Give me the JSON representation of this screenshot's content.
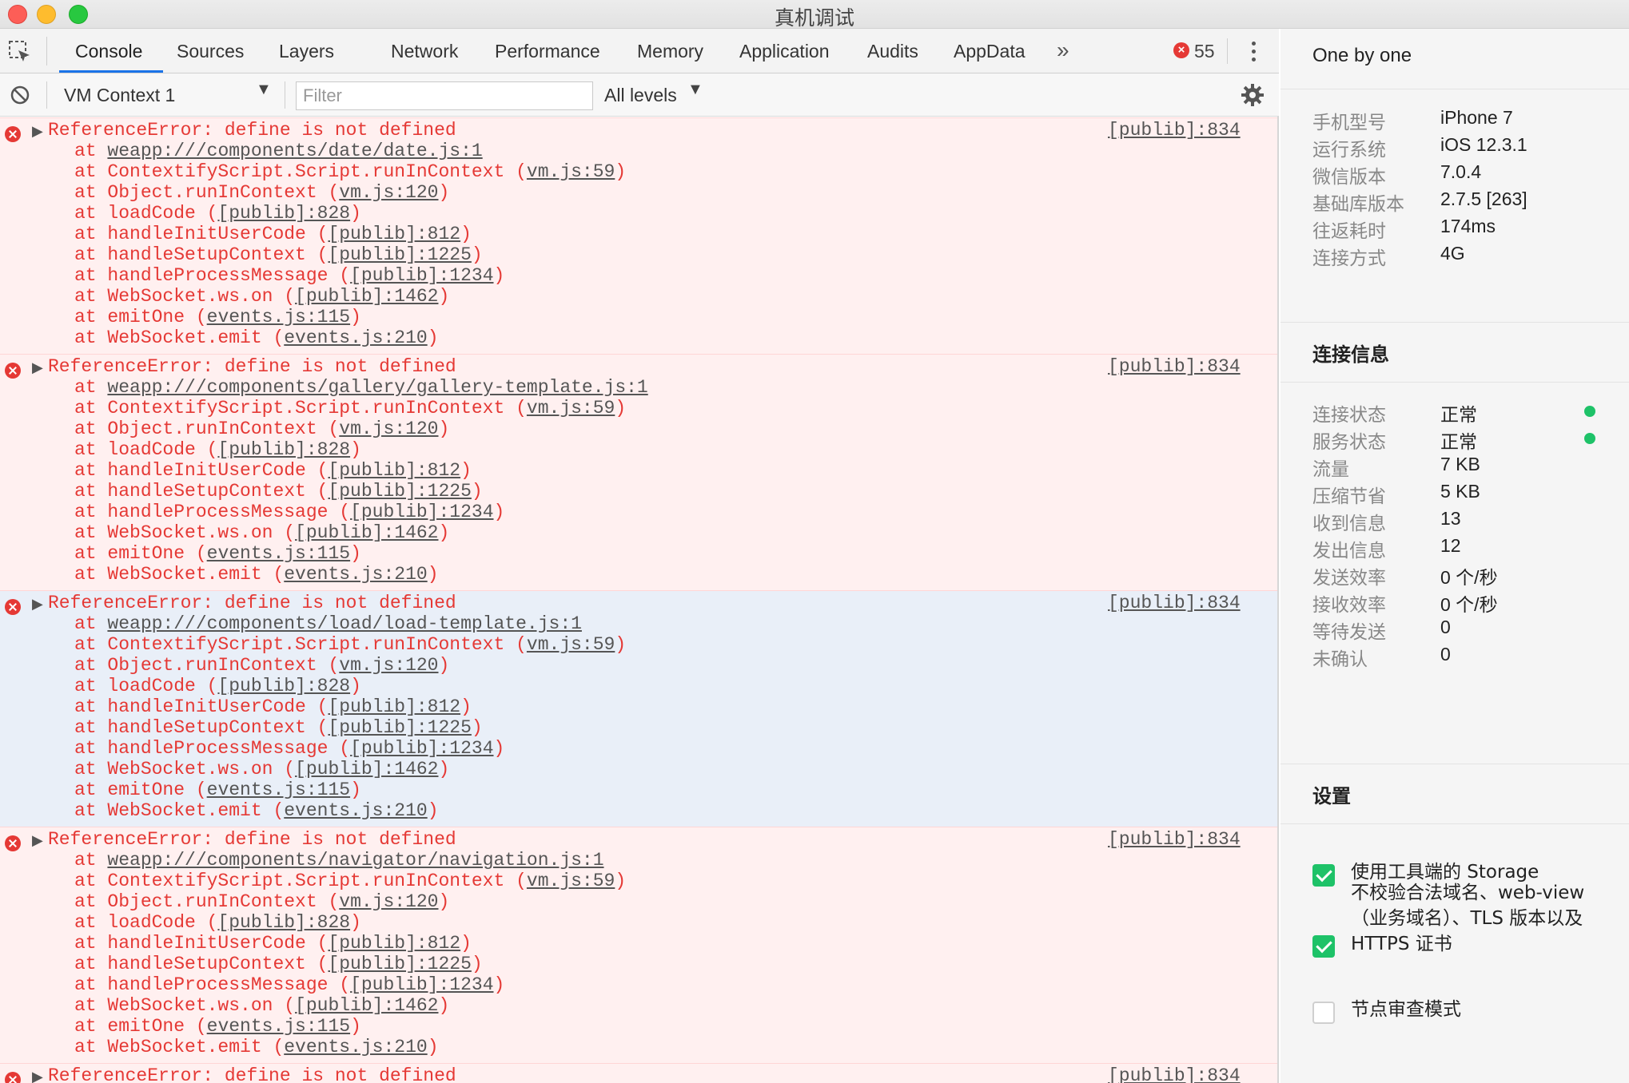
{
  "window": {
    "title": "真机调试"
  },
  "tabs": [
    "Console",
    "Sources",
    "Layers",
    "Network",
    "Performance",
    "Memory",
    "Application",
    "Audits",
    "AppData"
  ],
  "active_tab": "Console",
  "more_tabs_glyph": "»",
  "error_count": "55",
  "toolbar": {
    "context": "VM Context 1",
    "filter_placeholder": "Filter",
    "levels": "All levels",
    "caret": "▼"
  },
  "colors": {
    "error_red": "#e53935",
    "accent_blue": "#1a73e8",
    "status_green": "#1ec268",
    "selected_row": "#e9eff8",
    "error_row": "#fff0f0"
  },
  "console": {
    "entries": [
      {
        "message": "ReferenceError: define is not defined",
        "source": "[publib]:834",
        "selected": false,
        "frames": [
          {
            "pre": "at ",
            "link": "weapp:///components/date/date.js:1",
            "post": ""
          },
          {
            "pre": "at ContextifyScript.Script.runInContext (",
            "link": "vm.js:59",
            "post": ")"
          },
          {
            "pre": "at Object.runInContext (",
            "link": "vm.js:120",
            "post": ")"
          },
          {
            "pre": "at loadCode (",
            "link": "[publib]:828",
            "post": ")"
          },
          {
            "pre": "at handleInitUserCode (",
            "link": "[publib]:812",
            "post": ")"
          },
          {
            "pre": "at handleSetupContext (",
            "link": "[publib]:1225",
            "post": ")"
          },
          {
            "pre": "at handleProcessMessage (",
            "link": "[publib]:1234",
            "post": ")"
          },
          {
            "pre": "at WebSocket.ws.on (",
            "link": "[publib]:1462",
            "post": ")"
          },
          {
            "pre": "at emitOne (",
            "link": "events.js:115",
            "post": ")"
          },
          {
            "pre": "at WebSocket.emit (",
            "link": "events.js:210",
            "post": ")"
          }
        ]
      },
      {
        "message": "ReferenceError: define is not defined",
        "source": "[publib]:834",
        "selected": false,
        "frames": [
          {
            "pre": "at ",
            "link": "weapp:///components/gallery/gallery-template.js:1",
            "post": ""
          },
          {
            "pre": "at ContextifyScript.Script.runInContext (",
            "link": "vm.js:59",
            "post": ")"
          },
          {
            "pre": "at Object.runInContext (",
            "link": "vm.js:120",
            "post": ")"
          },
          {
            "pre": "at loadCode (",
            "link": "[publib]:828",
            "post": ")"
          },
          {
            "pre": "at handleInitUserCode (",
            "link": "[publib]:812",
            "post": ")"
          },
          {
            "pre": "at handleSetupContext (",
            "link": "[publib]:1225",
            "post": ")"
          },
          {
            "pre": "at handleProcessMessage (",
            "link": "[publib]:1234",
            "post": ")"
          },
          {
            "pre": "at WebSocket.ws.on (",
            "link": "[publib]:1462",
            "post": ")"
          },
          {
            "pre": "at emitOne (",
            "link": "events.js:115",
            "post": ")"
          },
          {
            "pre": "at WebSocket.emit (",
            "link": "events.js:210",
            "post": ")"
          }
        ]
      },
      {
        "message": "ReferenceError: define is not defined",
        "source": "[publib]:834",
        "selected": true,
        "frames": [
          {
            "pre": "at ",
            "link": "weapp:///components/load/load-template.js:1",
            "post": ""
          },
          {
            "pre": "at ContextifyScript.Script.runInContext (",
            "link": "vm.js:59",
            "post": ")"
          },
          {
            "pre": "at Object.runInContext (",
            "link": "vm.js:120",
            "post": ")"
          },
          {
            "pre": "at loadCode (",
            "link": "[publib]:828",
            "post": ")"
          },
          {
            "pre": "at handleInitUserCode (",
            "link": "[publib]:812",
            "post": ")"
          },
          {
            "pre": "at handleSetupContext (",
            "link": "[publib]:1225",
            "post": ")"
          },
          {
            "pre": "at handleProcessMessage (",
            "link": "[publib]:1234",
            "post": ")"
          },
          {
            "pre": "at WebSocket.ws.on (",
            "link": "[publib]:1462",
            "post": ")"
          },
          {
            "pre": "at emitOne (",
            "link": "events.js:115",
            "post": ")"
          },
          {
            "pre": "at WebSocket.emit (",
            "link": "events.js:210",
            "post": ")"
          }
        ]
      },
      {
        "message": "ReferenceError: define is not defined",
        "source": "[publib]:834",
        "selected": false,
        "frames": [
          {
            "pre": "at ",
            "link": "weapp:///components/navigator/navigation.js:1",
            "post": ""
          },
          {
            "pre": "at ContextifyScript.Script.runInContext (",
            "link": "vm.js:59",
            "post": ")"
          },
          {
            "pre": "at Object.runInContext (",
            "link": "vm.js:120",
            "post": ")"
          },
          {
            "pre": "at loadCode (",
            "link": "[publib]:828",
            "post": ")"
          },
          {
            "pre": "at handleInitUserCode (",
            "link": "[publib]:812",
            "post": ")"
          },
          {
            "pre": "at handleSetupContext (",
            "link": "[publib]:1225",
            "post": ")"
          },
          {
            "pre": "at handleProcessMessage (",
            "link": "[publib]:1234",
            "post": ")"
          },
          {
            "pre": "at WebSocket.ws.on (",
            "link": "[publib]:1462",
            "post": ")"
          },
          {
            "pre": "at emitOne (",
            "link": "events.js:115",
            "post": ")"
          },
          {
            "pre": "at WebSocket.emit (",
            "link": "events.js:210",
            "post": ")"
          }
        ]
      }
    ],
    "partial_entry": {
      "message": "ReferenceError: define is not defined",
      "source": "[publib]:834"
    }
  },
  "panel": {
    "header_title": "One by one",
    "device_info": [
      {
        "label": "手机型号",
        "value": "iPhone 7"
      },
      {
        "label": "运行系统",
        "value": "iOS 12.3.1"
      },
      {
        "label": "微信版本",
        "value": "7.0.4"
      },
      {
        "label": "基础库版本",
        "value": "2.7.5 [263]"
      },
      {
        "label": "往返耗时",
        "value": "174ms"
      },
      {
        "label": "连接方式",
        "value": "4G"
      }
    ],
    "connection_title": "连接信息",
    "connection_info": [
      {
        "label": "连接状态",
        "value": "正常",
        "dot": true
      },
      {
        "label": "服务状态",
        "value": "正常",
        "dot": true
      },
      {
        "label": "流量",
        "value": "7 KB",
        "dot": false
      },
      {
        "label": "压缩节省",
        "value": "5 KB",
        "dot": false
      },
      {
        "label": "收到信息",
        "value": "13",
        "dot": false
      },
      {
        "label": "发出信息",
        "value": "12",
        "dot": false
      },
      {
        "label": "发送效率",
        "value": "0 个/秒",
        "dot": false
      },
      {
        "label": "接收效率",
        "value": "0 个/秒",
        "dot": false
      },
      {
        "label": "等待发送",
        "value": "0",
        "dot": false
      },
      {
        "label": "未确认",
        "value": "0",
        "dot": false
      }
    ],
    "settings_title": "设置",
    "settings": [
      {
        "label": "使用工具端的 Storage",
        "checked": true
      },
      {
        "label": "不校验合法域名、web-view（业务域名）、TLS 版本以及 HTTPS 证书",
        "checked": true
      },
      {
        "label": "节点审查模式",
        "checked": false
      }
    ]
  }
}
